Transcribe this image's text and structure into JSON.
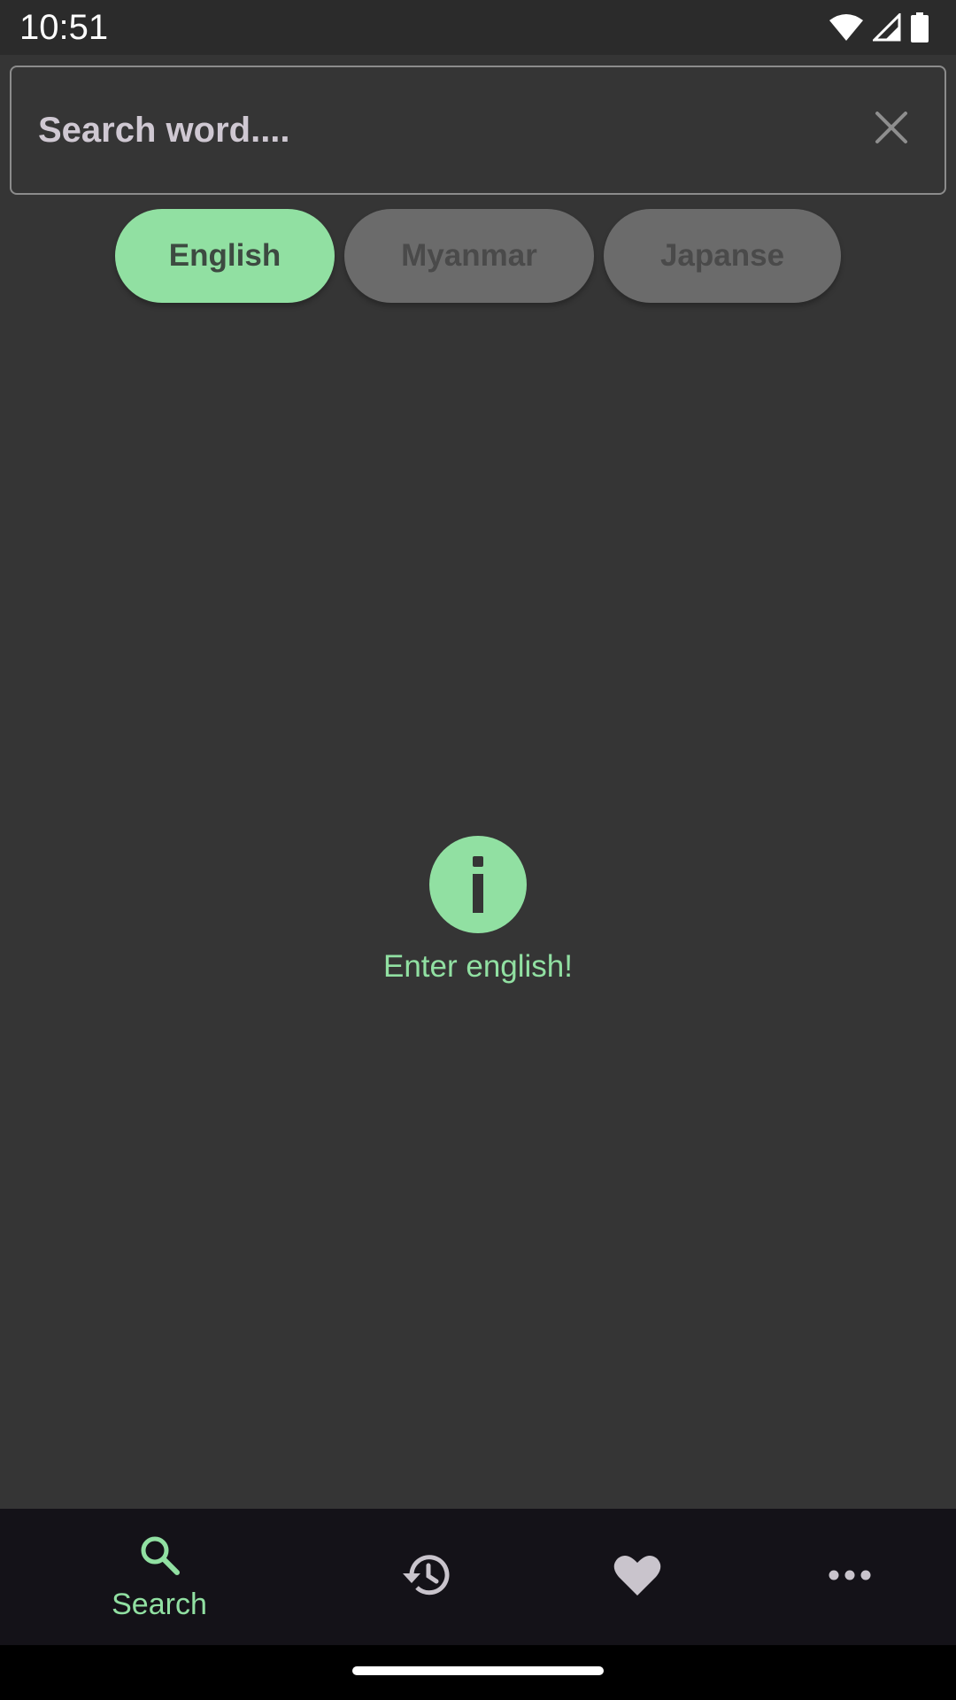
{
  "status_bar": {
    "time": "10:51",
    "icons": [
      "wifi-icon",
      "cellular-signal-icon",
      "battery-icon"
    ]
  },
  "search": {
    "placeholder": "Search word....",
    "value": "",
    "clear_icon": "close-icon"
  },
  "language_chips": [
    {
      "label": "English",
      "selected": true
    },
    {
      "label": "Myanmar",
      "selected": false
    },
    {
      "label": "Japanse",
      "selected": false
    }
  ],
  "empty_state": {
    "icon": "info-icon",
    "message": "Enter english!"
  },
  "bottom_nav": {
    "items": [
      {
        "icon": "search-icon",
        "label": "Search",
        "active": true
      },
      {
        "icon": "history-icon",
        "label": "",
        "active": false
      },
      {
        "icon": "heart-icon",
        "label": "",
        "active": false
      },
      {
        "icon": "more-horizontal-icon",
        "label": "",
        "active": false
      }
    ]
  },
  "colors": {
    "accent": "#91e0a2",
    "background": "#353535",
    "nav_background": "#141218",
    "chip_unselected": "#6b6b6b"
  }
}
